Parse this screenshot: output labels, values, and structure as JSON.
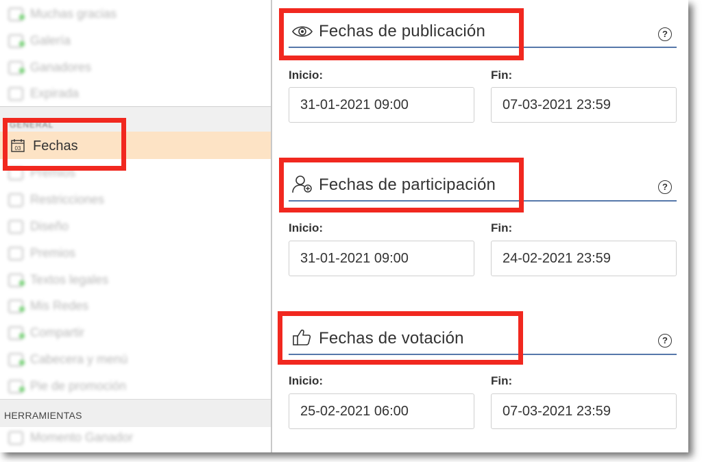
{
  "sidebar": {
    "blurred_items_top": [
      {
        "label": "Muchas gracias",
        "icon": "check-icon"
      },
      {
        "label": "Galería",
        "icon": "user-icon"
      },
      {
        "label": "Ganadores",
        "icon": "trophy-icon"
      },
      {
        "label": "Expirada",
        "icon": "user-icon"
      }
    ],
    "section_general": "GENERAL",
    "active_item": {
      "label": "Fechas",
      "icon": "calendar-icon",
      "icon_text": "03"
    },
    "blurred_items_bottom": [
      {
        "label": "Premios",
        "icon": "user-icon"
      },
      {
        "label": "Restricciones",
        "icon": "user-icon"
      },
      {
        "label": "Diseño",
        "icon": "palette-icon"
      },
      {
        "label": "Premios",
        "icon": "gift-icon"
      },
      {
        "label": "Textos legales",
        "icon": "legal-icon"
      },
      {
        "label": "Mis Redes",
        "icon": "network-icon"
      },
      {
        "label": "Compartir",
        "icon": "share-icon"
      },
      {
        "label": "Cabecera y menú",
        "icon": "layout-icon"
      },
      {
        "label": "Pie de promoción",
        "icon": "footer-icon"
      }
    ],
    "section_tools": "HERRAMIENTAS",
    "tools_items": [
      {
        "label": "Momento Ganador",
        "icon": "clock-icon"
      }
    ]
  },
  "main": {
    "sections": [
      {
        "title": "Fechas de publicación",
        "icon": "eye-icon",
        "help": "?",
        "start_label": "Inicio:",
        "start_value": "31-01-2021 09:00",
        "end_label": "Fin:",
        "end_value": "07-03-2021 23:59"
      },
      {
        "title": "Fechas de participación",
        "icon": "user-plus-icon",
        "help": "?",
        "start_label": "Inicio:",
        "start_value": "31-01-2021 09:00",
        "end_label": "Fin:",
        "end_value": "24-02-2021 23:59"
      },
      {
        "title": "Fechas de votación",
        "icon": "thumbs-up-icon",
        "help": "?",
        "start_label": "Inicio:",
        "start_value": "25-02-2021 06:00",
        "end_label": "Fin:",
        "end_value": "07-03-2021 23:59"
      }
    ]
  },
  "colors": {
    "highlight": "#f1281f",
    "active_row": "#fde3c5",
    "section_line": "#5577aa",
    "status_dot": "#3fbf3f"
  }
}
